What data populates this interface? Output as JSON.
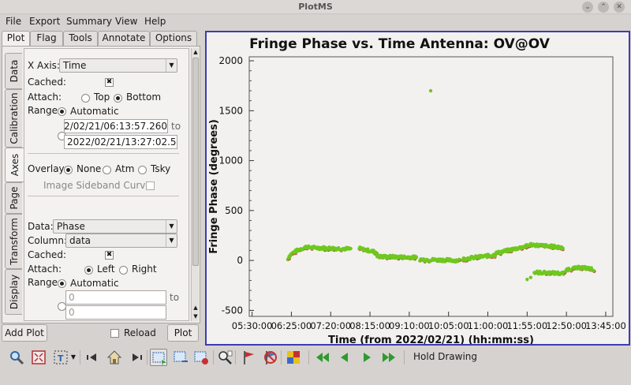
{
  "window": {
    "title": "PlotMS"
  },
  "menu": [
    "File",
    "Export",
    "Summary",
    "View",
    "Help"
  ],
  "top_tabs": [
    "Plot",
    "Flag",
    "Tools",
    "Annotate",
    "Options"
  ],
  "side_tabs": [
    "Data",
    "Calibration",
    "Axes",
    "Page",
    "Transform",
    "Display"
  ],
  "axes": {
    "x_axis_label": "X Axis:",
    "x_axis_value": "Time",
    "cached_label": "Cached:",
    "attach_label": "Attach:",
    "attach_top": "Top",
    "attach_bottom": "Bottom",
    "range_label": "Range:",
    "automatic": "Automatic",
    "range_from": "2022/02/21/06:13:57.260",
    "range_to_word": "to",
    "range_to": "2022/02/21/13:27:02.560",
    "overlay_label": "Overlay:",
    "overlay_none": "None",
    "overlay_atm": "Atm",
    "overlay_tsky": "Tsky",
    "sideband_label": "Image Sideband Curve:",
    "data_label": "Data:",
    "data_value": "Phase",
    "column_label": "Column:",
    "column_value": "data",
    "y_cached_label": "Cached:",
    "y_attach_label": "Attach:",
    "attach_left": "Left",
    "attach_right": "Right",
    "y_range_label": "Range:",
    "y_automatic": "Automatic",
    "y_range_from": "0",
    "y_range_to_word": "to",
    "y_range_to": "0"
  },
  "buttons": {
    "add_plot": "Add Plot",
    "reload": "Reload",
    "plot": "Plot"
  },
  "toolbar": {
    "hold_drawing": "Hold Drawing"
  },
  "colors": {
    "frame": "#3c3cb4",
    "points_green": "#6ec81e",
    "points_red": "#c83c3c"
  },
  "chart_data": {
    "type": "scatter",
    "title": "Fringe Phase vs. Time Antenna: OV@OV",
    "xlabel": "Time (from 2022/02/21) (hh:mm:ss)",
    "ylabel": "Fringe Phase (degrees)",
    "x_ticks": [
      "05:30:00",
      "06:25:00",
      "07:20:00",
      "08:15:00",
      "09:10:00",
      "10:05:00",
      "11:00:00",
      "11:55:00",
      "12:50:00",
      "13:45:00"
    ],
    "y_ticks": [
      -500,
      0,
      500,
      1000,
      1500,
      2000
    ],
    "ylim": [
      -560,
      2040
    ],
    "xlim": [
      "05:26:00",
      "13:55:00"
    ],
    "grid": false,
    "segments": [
      {
        "start": "06:20:00",
        "end": "06:48:00",
        "from": 10,
        "to": 140,
        "shape": "rise"
      },
      {
        "start": "06:48:00",
        "end": "07:48:00",
        "from": 130,
        "to": 115,
        "shape": "flat"
      },
      {
        "start": "08:00:00",
        "end": "08:25:00",
        "from": 120,
        "to": 80,
        "shape": "flat"
      },
      {
        "start": "08:25:00",
        "end": "09:20:00",
        "from": 40,
        "to": 30,
        "shape": "flat"
      },
      {
        "start": "09:25:00",
        "end": "10:20:00",
        "from": 10,
        "to": 0,
        "shape": "flat"
      },
      {
        "start": "10:25:00",
        "end": "11:10:00",
        "from": 15,
        "to": 55,
        "shape": "flat"
      },
      {
        "start": "11:10:00",
        "end": "11:58:00",
        "from": 70,
        "to": 150,
        "shape": "flat"
      },
      {
        "start": "11:58:00",
        "end": "12:45:00",
        "from": 160,
        "to": 130,
        "shape": "flat"
      },
      {
        "start": "12:05:00",
        "end": "12:47:00",
        "from": -120,
        "to": -130,
        "shape": "flat"
      },
      {
        "start": "12:50:00",
        "end": "13:12:00",
        "from": -90,
        "to": -70,
        "shape": "flat"
      },
      {
        "start": "13:12:00",
        "end": "13:28:00",
        "from": -70,
        "to": -90,
        "shape": "flat"
      }
    ],
    "outliers": [
      {
        "x": "09:40:00",
        "y": 1700
      },
      {
        "x": "11:55:00",
        "y": -190
      },
      {
        "x": "12:00:00",
        "y": -170
      }
    ]
  }
}
